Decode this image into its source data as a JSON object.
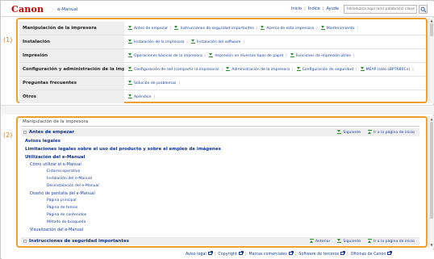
{
  "header": {
    "logo": "Canon",
    "product": "e-Manual",
    "links": [
      "Inicio",
      "Índice",
      "Ayuda"
    ],
    "search_placeholder": "Introduzca aquí la(s) palabra(s) clave"
  },
  "markers": [
    "(1)",
    "(2)"
  ],
  "categories": [
    {
      "name": "Manipulación de la impresora",
      "links": [
        "Antes de empezar",
        "Instrucciones de seguridad importantes",
        "Acerca de esta impresora",
        "Mantenimiento"
      ]
    },
    {
      "name": "Instalación",
      "links": [
        "Instalación de la impresora",
        "Instalación del software"
      ]
    },
    {
      "name": "Impresión",
      "links": [
        "Operaciones básicas de la impresora",
        "Impresión en diversos tipos de papel",
        "Funciones de impresión útiles"
      ]
    },
    {
      "name": "Configuración y administración de la impresora",
      "links": [
        "Configuración de red (compartir la impresora)",
        "Administración de la impresora",
        "Configuración de seguridad",
        "MEAP (sólo LBP7680Cx)"
      ]
    },
    {
      "name": "Preguntas frecuentes",
      "links": [
        "Solución de problemas"
      ]
    },
    {
      "name": "Otros",
      "links": [
        "Apéndice"
      ]
    }
  ],
  "content": {
    "section_title": "Manipulación de la impresora",
    "subsection1": {
      "title": "Antes de empezar",
      "nav": [
        "Siguiente",
        "Ir a la página de inicio"
      ]
    },
    "tree": [
      {
        "text": "Avisos legales",
        "level": "bold"
      },
      {
        "text": "Limitaciones legales sobre el uso del producto y sobre el empleo de imágenes",
        "level": "bold"
      },
      {
        "text": "Utilización del e-Manual",
        "level": "bold"
      },
      {
        "text": "Cómo utilizar el e-Manual",
        "level": "l1"
      },
      {
        "text": "Entorno operativo",
        "level": "l2"
      },
      {
        "text": "Instalación del e-Manual",
        "level": "l2"
      },
      {
        "text": "Desinstalación del e-Manual",
        "level": "l2"
      },
      {
        "text": "Diseño de pantalla del e-Manual",
        "level": "l1"
      },
      {
        "text": "Página principal",
        "level": "l2"
      },
      {
        "text": "Página de temas",
        "level": "l2"
      },
      {
        "text": "Página de contenidos",
        "level": "l2"
      },
      {
        "text": "Método de búsqueda",
        "level": "l2"
      },
      {
        "text": "Visualización del e-Manual",
        "level": "l1"
      }
    ],
    "subsection2": {
      "title": "Instrucciones de seguridad importantes",
      "nav": [
        "Anterior",
        "Siguiente",
        "Ir a la página de inicio"
      ]
    }
  },
  "footer": {
    "links": [
      "Aviso legal",
      "Copyright",
      "Marcas comerciales",
      "Software de terceros",
      "Oficinas de Canon"
    ]
  },
  "colors": {
    "accent_border": "#f0a030",
    "link": "#1a3fa0",
    "logo": "#cc0000",
    "arrow": "#2d8c2d"
  }
}
